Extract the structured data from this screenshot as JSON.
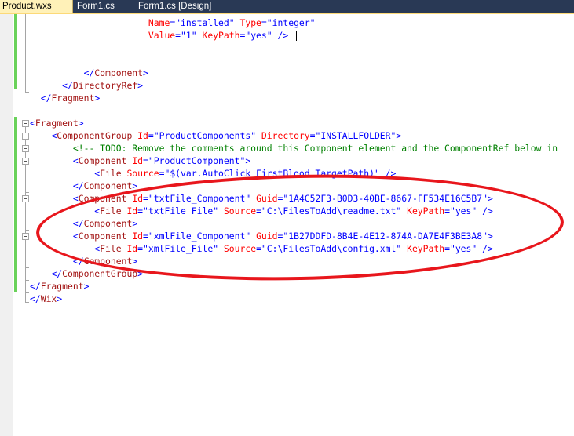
{
  "tabs": [
    {
      "label": "Product.wxs",
      "active": true
    },
    {
      "label": "Form1.cs",
      "active": false
    },
    {
      "label": "Form1.cs [Design]",
      "active": false
    }
  ],
  "colors": {
    "tab_strip": "#293955",
    "active_tab": "#fff1b8",
    "xml_delimiter": "#0000ff",
    "xml_element_name": "#a31515",
    "xml_attribute_name": "#ff0000",
    "xml_attribute_value": "#0000ff",
    "xml_comment": "#008000",
    "change_marker": "#6ad25a",
    "annotation_ellipse": "#e8161c"
  },
  "code": {
    "l1": {
      "i": "                      ",
      "a1": "Name",
      "e1": "=\"",
      "v1": "installed",
      "e2": "\" ",
      "a2": "Type",
      "e3": "=\"",
      "v2": "integer",
      "e4": "\""
    },
    "l2": {
      "i": "                      ",
      "a1": "Value",
      "e1": "=\"",
      "v1": "1",
      "e2": "\" ",
      "a2": "KeyPath",
      "e3": "=\"",
      "v2": "yes",
      "e4": "\" />"
    },
    "l5": {
      "i": "          ",
      "p": "</",
      "n": "Component",
      "s": ">"
    },
    "l6": {
      "i": "      ",
      "p": "</",
      "n": "DirectoryRef",
      "s": ">"
    },
    "l7": {
      "i": "  ",
      "p": "</",
      "n": "Fragment",
      "s": ">"
    },
    "l9": {
      "p": "<",
      "n": "Fragment",
      "s": ">"
    },
    "l10": {
      "i": "    ",
      "p": "<",
      "n": "ComponentGroup",
      "sp": " ",
      "a1": "Id",
      "e1": "=\"",
      "v1": "ProductComponents",
      "e2": "\" ",
      "a2": "Directory",
      "e3": "=\"",
      "v2": "INSTALLFOLDER",
      "e4": "\">"
    },
    "l11": {
      "i": "        ",
      "c": "<!-- TODO: Remove the comments around this Component element and the ComponentRef below in"
    },
    "l12": {
      "i": "        ",
      "p": "<",
      "n": "Component",
      "sp": " ",
      "a1": "Id",
      "e1": "=\"",
      "v1": "ProductComponent",
      "e2": "\">"
    },
    "l13": {
      "i": "            ",
      "p": "<",
      "n": "File",
      "sp": " ",
      "a1": "Source",
      "e1": "=\"",
      "v1": "$(var.AutoClick_FirstBlood.TargetPath)",
      "e2": "\" />"
    },
    "l14": {
      "i": "        ",
      "p": "</",
      "n": "Component",
      "s": ">"
    },
    "l15": {
      "i": "        ",
      "p": "<",
      "n": "Component",
      "sp": " ",
      "a1": "Id",
      "e1": "=\"",
      "v1": "txtFile_Component",
      "e2": "\" ",
      "a2": "Guid",
      "e3": "=\"",
      "v2": "1A4C52F3-B0D3-40BE-8667-FF534E16C5B7",
      "e4": "\">"
    },
    "l16": {
      "i": "            ",
      "p": "<",
      "n": "File",
      "sp": " ",
      "a1": "Id",
      "e1": "=\"",
      "v1": "txtFile_File",
      "e2": "\" ",
      "a2": "Source",
      "e3": "=\"",
      "v2": "C:\\FilesToAdd\\readme.txt",
      "e4": "\" ",
      "a3": "KeyPath",
      "e5": "=\"",
      "v3": "yes",
      "e6": "\" />"
    },
    "l17": {
      "i": "        ",
      "p": "</",
      "n": "Component",
      "s": ">"
    },
    "l18": {
      "i": "        ",
      "p": "<",
      "n": "Component",
      "sp": " ",
      "a1": "Id",
      "e1": "=\"",
      "v1": "xmlFile_Component",
      "e2": "\" ",
      "a2": "Guid",
      "e3": "=\"",
      "v2": "1B27DDFD-8B4E-4E12-874A-DA7E4F3BE3A8",
      "e4": "\">"
    },
    "l19": {
      "i": "            ",
      "p": "<",
      "n": "File",
      "sp": " ",
      "a1": "Id",
      "e1": "=\"",
      "v1": "xmlFile_File",
      "e2": "\" ",
      "a2": "Source",
      "e3": "=\"",
      "v2": "C:\\FilesToAdd\\config.xml",
      "e4": "\" ",
      "a3": "KeyPath",
      "e5": "=\"",
      "v3": "yes",
      "e6": "\" />"
    },
    "l20": {
      "i": "        ",
      "p": "</",
      "n": "Component",
      "s": ">"
    },
    "l21": {
      "i": "    ",
      "p": "</",
      "n": "ComponentGroup",
      "s": ">"
    },
    "l22": {
      "p": "</",
      "n": "Fragment",
      "s": ">"
    },
    "l23": {
      "p": "</",
      "n": "Wix",
      "s": ">"
    }
  }
}
